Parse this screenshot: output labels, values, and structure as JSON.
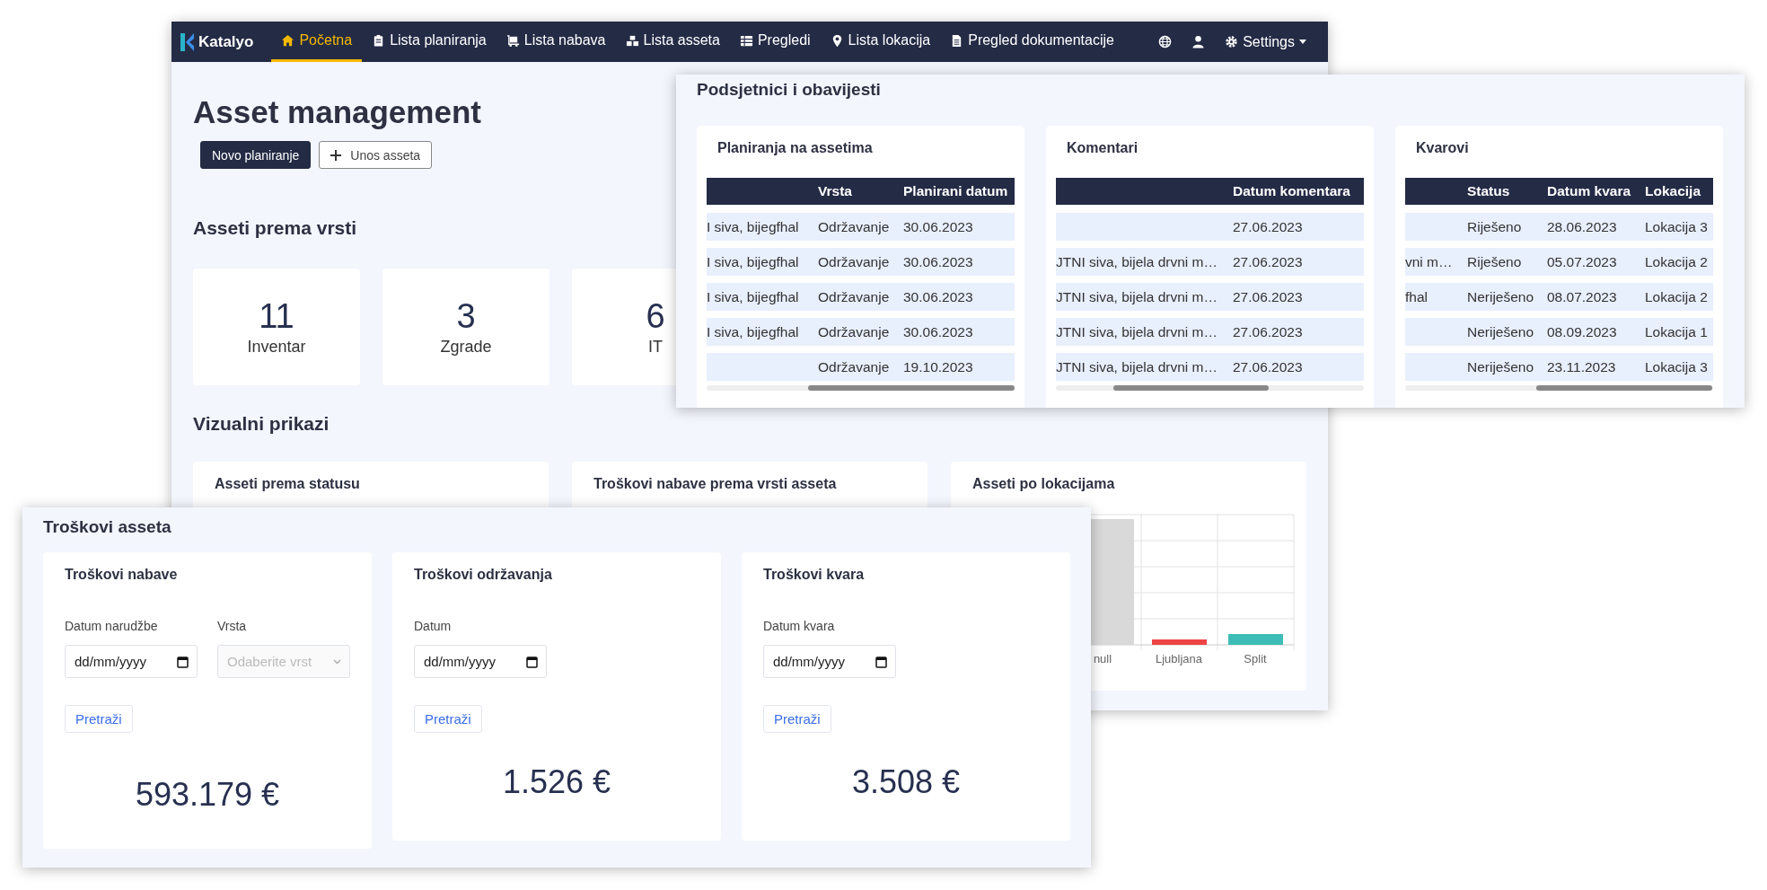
{
  "main_window": {
    "navbar": {
      "brand": "Katalyo",
      "items": [
        {
          "label": "Početna",
          "selected": true
        },
        {
          "label": "Lista planiranja",
          "selected": false
        },
        {
          "label": "Lista nabava",
          "selected": false
        },
        {
          "label": "Lista asseta",
          "selected": false
        },
        {
          "label": "Pregledi",
          "selected": false
        },
        {
          "label": "Lista lokacija",
          "selected": false
        },
        {
          "label": "Pregled dokumentacije",
          "selected": false
        }
      ],
      "settings": "Settings"
    },
    "title": "Asset management",
    "buttons": [
      {
        "label": "Novo planiranje",
        "kind": "primary"
      },
      {
        "label": "Unos asseta",
        "kind": "add"
      }
    ],
    "asset_types": {
      "title": "Asseti prema vrsti",
      "cards": [
        {
          "value": "11",
          "label": "Inventar"
        },
        {
          "value": "3",
          "label": "Zgrade"
        },
        {
          "value": "6",
          "label": "IT"
        }
      ]
    },
    "visuals": {
      "title": "Vizualni prikazi",
      "cards": [
        {
          "title": "Asseti prema statusu"
        },
        {
          "title": "Troškovi nabave prema vrsti asseta"
        },
        {
          "title": "Asseti po lokacijama",
          "chart": {
            "kind": "picture",
            "x_labels": [
              "null",
              "Ljubljana",
              "Split"
            ]
          }
        }
      ]
    }
  },
  "reminders_panel": {
    "title": "Podsjetnici i obavijesti",
    "cards": [
      {
        "title": "Planiranja na assetima",
        "columns": [
          "Vrsta",
          "Planirani datum"
        ],
        "rows": [
          {
            "column_1": "I siva, bijegfhal",
            "cells": [
              "Održavanje",
              "30.06.2023"
            ]
          },
          {
            "column_1": "I siva, bijegfhal",
            "cells": [
              "Održavanje",
              "30.06.2023"
            ]
          },
          {
            "column_1": "I siva, bijegfhal",
            "cells": [
              "Održavanje",
              "30.06.2023"
            ]
          },
          {
            "column_1": "I siva, bijegfhal",
            "cells": [
              "Održavanje",
              "30.06.2023"
            ]
          },
          {
            "cells": [
              "Održavanje",
              "19.10.2023"
            ]
          }
        ]
      },
      {
        "title": "Komentari",
        "columns": [
          "Datum komentara"
        ],
        "rows": [
          {
            "cells": [
              "27.06.2023"
            ]
          },
          {
            "column_1": "JTNI siva, bijela drvni m…",
            "cells": [
              "27.06.2023"
            ]
          },
          {
            "column_1": "JTNI siva, bijela drvni m…",
            "cells": [
              "27.06.2023"
            ]
          },
          {
            "column_1": "JTNI siva, bijela drvni m…",
            "cells": [
              "27.06.2023"
            ]
          },
          {
            "column_1": "JTNI siva, bijela drvni m…",
            "cells": [
              "27.06.2023"
            ]
          }
        ]
      },
      {
        "title": "Kvarovi",
        "columns": [
          "Status",
          "Datum kvara",
          "Lokacija"
        ],
        "rows": [
          {
            "cells": [
              "Riješeno",
              "28.06.2023",
              "Lokacija 3"
            ]
          },
          {
            "column_1": "vni m…",
            "cells": [
              "Riješeno",
              "05.07.2023",
              "Lokacija 2"
            ]
          },
          {
            "column_1": "fhal",
            "cells": [
              "Neriješeno",
              "08.07.2023",
              "Lokacija 2"
            ]
          },
          {
            "cells": [
              "Neriješeno",
              "08.09.2023",
              "Lokacija 1"
            ]
          },
          {
            "cells": [
              "Neriješeno",
              "23.11.2023",
              "Lokacija 3"
            ]
          }
        ]
      }
    ]
  },
  "costs_panel": {
    "title": "Troškovi asseta",
    "cards": [
      {
        "title": "Troškovi nabave",
        "fields": [
          {
            "label": "Datum narudžbe",
            "kind": "date",
            "placeholder": "dd/mm/yyyy"
          },
          {
            "label": "Vrsta",
            "kind": "select",
            "placeholder": "Odaberite vrst",
            "disabled": true
          }
        ],
        "button": "Pretraži",
        "amount": "593.179 €"
      },
      {
        "title": "Troškovi održavanja",
        "fields": [
          {
            "label": "Datum",
            "kind": "date",
            "placeholder": "dd/mm/yyyy"
          }
        ],
        "button": "Pretraži",
        "amount": "1.526 €"
      },
      {
        "title": "Troškovi kvara",
        "fields": [
          {
            "label": "Datum kvara",
            "kind": "date",
            "placeholder": "dd/mm/yyyy"
          }
        ],
        "button": "Pretraži",
        "amount": "3.508 €"
      }
    ]
  }
}
